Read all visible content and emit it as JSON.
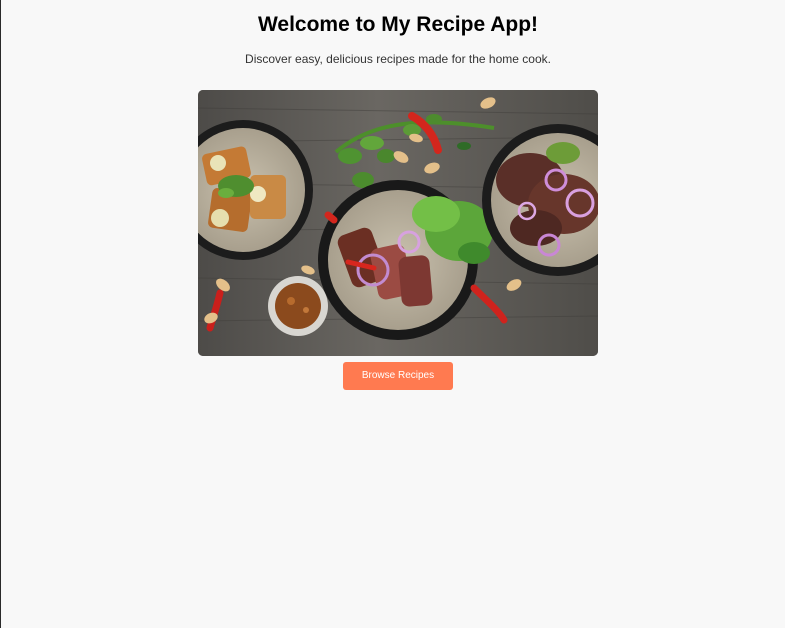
{
  "page": {
    "title": "Welcome to My Recipe App!",
    "subtitle": "Discover easy, delicious recipes made for the home cook."
  },
  "hero": {
    "image_subject": "overhead-food-photo",
    "items": [
      "fried-rolls-plate",
      "sliced-steak-plate",
      "salad-plate",
      "dipping-sauce",
      "chili-peppers",
      "cashews",
      "herbs"
    ]
  },
  "actions": {
    "browse_label": "Browse Recipes"
  },
  "colors": {
    "background": "#f8f8f8",
    "button": "#ff7a50",
    "button_text": "#ffffff",
    "title": "#000000",
    "subtitle": "#333333",
    "table": "#5d5b57"
  }
}
